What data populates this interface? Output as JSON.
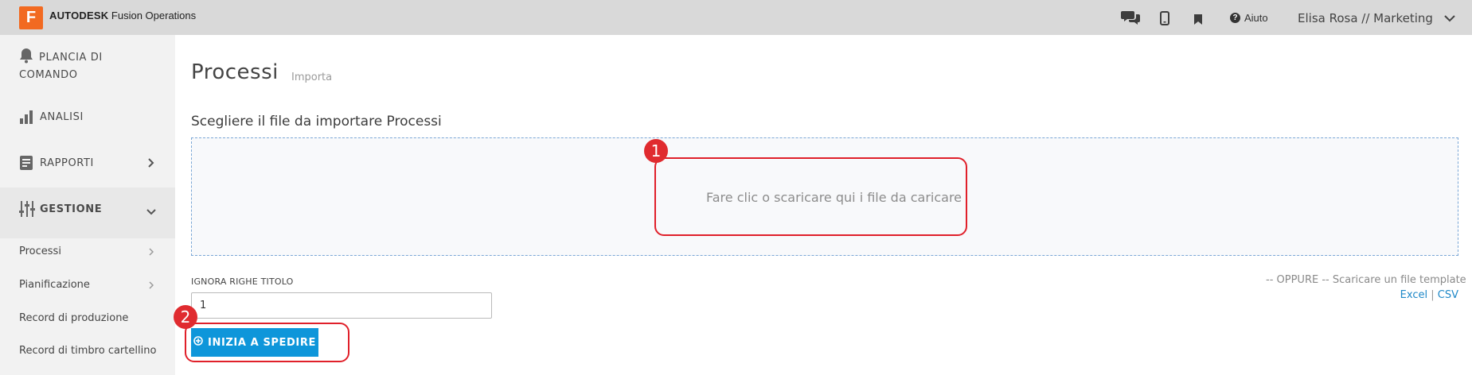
{
  "app": {
    "logo_letter": "F",
    "brand_bold": "AUTODESK",
    "brand_rest": " Fusion Operations",
    "brand_color": "#f26a21"
  },
  "topbar": {
    "icons": [
      "chat-icon",
      "mobile-icon",
      "bookmark-icon"
    ],
    "help_label": "Aiuto",
    "user_label": "Elisa Rosa // Marketing"
  },
  "sidebar": {
    "items": [
      {
        "label_line1": "PLANCIA DI",
        "label_line2": "COMANDO",
        "icon": "bell-icon"
      },
      {
        "label": "ANALISI",
        "icon": "bar-chart-icon"
      },
      {
        "label": "RAPPORTI",
        "icon": "report-icon"
      },
      {
        "label": "GESTIONE",
        "icon": "sliders-icon"
      }
    ],
    "sub_items": [
      {
        "label": "Processi"
      },
      {
        "label": "Pianificazione"
      },
      {
        "label": "Record di produzione"
      },
      {
        "label": "Record di timbro cartellino"
      }
    ]
  },
  "main": {
    "title": "Processi",
    "subtitle": "Importa",
    "section_label": "Scegliere il file da importare Processi",
    "dropzone_text": "Fare clic o scaricare qui i file da caricare",
    "ignore_label": "IGNORA RIGHE TITOLO",
    "ignore_value": "1",
    "template_text": "-- OPPURE -- Scaricare un file template",
    "link_excel": "Excel",
    "link_sep": "|",
    "link_csv": "CSV",
    "start_button": "INIZIA A SPEDIRE"
  },
  "annotations": [
    {
      "number": "1",
      "target": "dropzone"
    },
    {
      "number": "2",
      "target": "start-button"
    }
  ],
  "colors": {
    "accent": "#0e96da",
    "annotation": "#e02b2f"
  }
}
